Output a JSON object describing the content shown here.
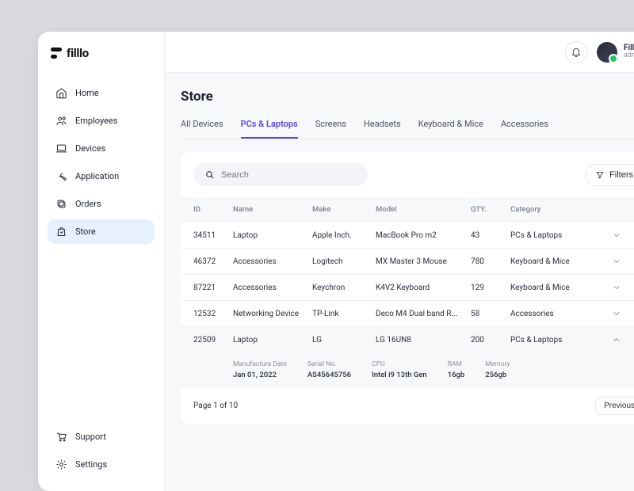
{
  "brand": "filllo",
  "user": {
    "name": "Filllo",
    "role": "admin"
  },
  "sidebar": {
    "items": [
      {
        "label": "Home"
      },
      {
        "label": "Employees"
      },
      {
        "label": "Devices"
      },
      {
        "label": "Application"
      },
      {
        "label": "Orders"
      },
      {
        "label": "Store"
      }
    ],
    "footer": [
      {
        "label": "Support"
      },
      {
        "label": "Settings"
      }
    ]
  },
  "page": {
    "title": "Store"
  },
  "tabs": [
    {
      "label": "All Devices"
    },
    {
      "label": "PCs & Laptops"
    },
    {
      "label": "Screens"
    },
    {
      "label": "Headsets"
    },
    {
      "label": "Keyboard & Mice"
    },
    {
      "label": "Accessories"
    }
  ],
  "search": {
    "placeholder": "Search"
  },
  "filters_label": "Filters",
  "table": {
    "headers": {
      "id": "ID",
      "name": "Name",
      "make": "Make",
      "model": "Model",
      "qty": "QTY.",
      "category": "Category"
    },
    "rows": [
      {
        "id": "34511",
        "name": "Laptop",
        "make": "Apple Inch.",
        "model": "MacBook Pro m2",
        "qty": "43",
        "category": "PCs & Laptops",
        "expanded": false
      },
      {
        "id": "46372",
        "name": "Accessories",
        "make": "Logitech",
        "model": "MX Master 3 Mouse",
        "qty": "780",
        "category": "Keyboard & Mice",
        "expanded": false
      },
      {
        "id": "87221",
        "name": "Accessories",
        "make": "Keychron",
        "model": "K4V2 Keyboard",
        "qty": "129",
        "category": "Keyboard & Mice",
        "expanded": false
      },
      {
        "id": "12532",
        "name": "Networking Device",
        "make": "TP-Link",
        "model": "Deco M4 Dual band R...",
        "qty": "58",
        "category": "Accessories",
        "expanded": false
      },
      {
        "id": "22509",
        "name": "Laptop",
        "make": "LG",
        "model": "LG 16UN8",
        "qty": "200",
        "category": "PCs & Laptops",
        "expanded": true
      }
    ]
  },
  "detail": {
    "labels": {
      "date": "Manufacture Date",
      "serial": "Serial No.",
      "cpu": "CPU",
      "ram": "RAM",
      "memory": "Memory"
    },
    "values": {
      "date": "Jan 01, 2022",
      "serial": "AS45645756",
      "cpu": "Intel i9 13th Gen",
      "ram": "16gb",
      "memory": "256gb"
    }
  },
  "pager": {
    "status": "Page 1 of 10",
    "prev": "Previous"
  }
}
